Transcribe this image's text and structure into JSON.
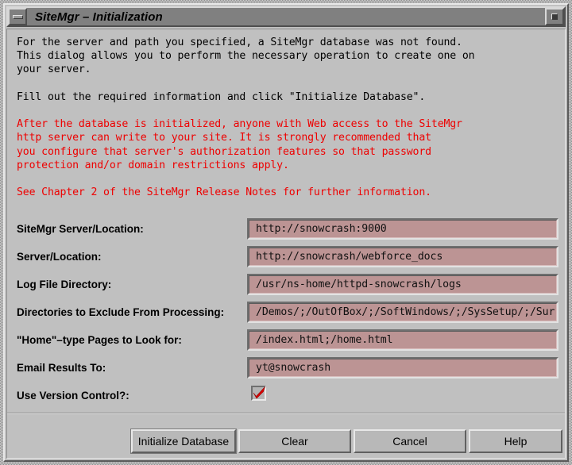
{
  "window": {
    "title": "SiteMgr – Initialization",
    "minimize_icon": "minimize-icon",
    "maximize_icon": "maximize-icon",
    "bg_color": "#c0c0c0",
    "titlebar_color": "#808080",
    "field_color": "#bc9494",
    "warning_color": "#ee0000"
  },
  "message": {
    "paragraph1": [
      "For the server and path you specified, a SiteMgr database was not found.",
      "This dialog allows you to perform the necessary operation to create one on",
      "your server."
    ],
    "paragraph2": [
      "Fill out the required information and click \"Initialize Database\"."
    ],
    "warning": [
      "After the database is initialized, anyone with Web access to the SiteMgr",
      "http server can write to your site. It is strongly recommended that",
      "you configure that server's authorization features so that password",
      "protection and/or domain restrictions apply."
    ],
    "warning_footer": [
      "See Chapter 2 of the SiteMgr Release Notes for further information."
    ]
  },
  "form": {
    "fields": [
      {
        "label": "SiteMgr Server/Location:",
        "value": "http://snowcrash:9000",
        "name": "sitemgr-server-location"
      },
      {
        "label": "Server/Location:",
        "value": "http://snowcrash/webforce_docs",
        "name": "server-location"
      },
      {
        "label": "Log File Directory:",
        "value": "/usr/ns-home/httpd-snowcrash/logs",
        "name": "log-file-directory"
      },
      {
        "label": "Directories to Exclude From Processing:",
        "value": "/Demos/;/OutOfBox/;/SoftWindows/;/SysSetup/;/Sur",
        "name": "exclude-directories"
      },
      {
        "label": "\"Home\"–type Pages to Look for:",
        "value": "/index.html;/home.html",
        "name": "home-type-pages"
      },
      {
        "label": "Email Results To:",
        "value": "yt@snowcrash",
        "name": "email-results-to"
      }
    ],
    "checkbox": {
      "label": "Use Version Control?:",
      "checked": true,
      "name": "use-version-control"
    }
  },
  "buttons": [
    {
      "label": "Initialize Database",
      "name": "initialize-database-button"
    },
    {
      "label": "Clear",
      "name": "clear-button"
    },
    {
      "label": "Cancel",
      "name": "cancel-button"
    },
    {
      "label": "Help",
      "name": "help-button"
    }
  ]
}
